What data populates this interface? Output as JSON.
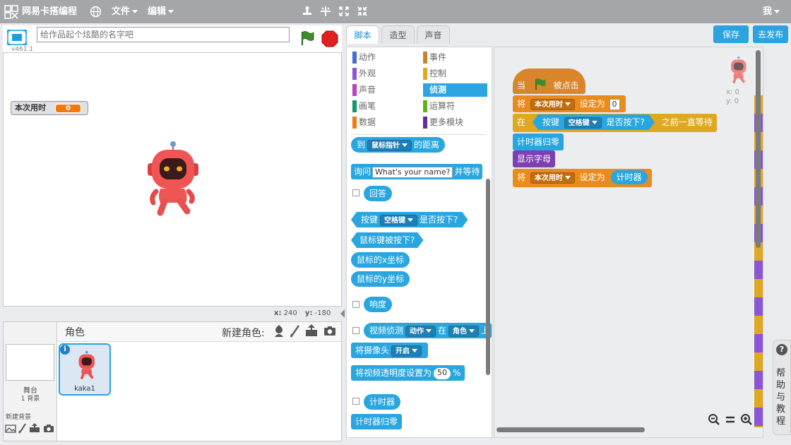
{
  "menubar": {
    "app_title": "网易卡搭编程",
    "file": "文件",
    "edit": "编辑",
    "user": "我"
  },
  "stage": {
    "project_placeholder": "给作品起个炫酷的名字吧",
    "version": "v461.1",
    "coord_x_label": "x:",
    "coord_x": "240",
    "coord_y_label": "y:",
    "coord_y": "-180"
  },
  "watcher": {
    "label": "本次用时",
    "value": "0"
  },
  "sprites": {
    "header": "角色",
    "new_sprite": "新建角色:",
    "sprite_name": "kaka1",
    "stage_label": "舞台",
    "backdrop_count": "1 背景",
    "new_backdrop": "新建背景"
  },
  "tabs": {
    "scripts": "脚本",
    "costumes": "造型",
    "sounds": "声音"
  },
  "actions": {
    "save": "保存",
    "publish": "去发布"
  },
  "categories": [
    {
      "label": "动作",
      "color": "#4a6cd4"
    },
    {
      "label": "事件",
      "color": "#c88330"
    },
    {
      "label": "外观",
      "color": "#8a55d7"
    },
    {
      "label": "控制",
      "color": "#e1a91a"
    },
    {
      "label": "声音",
      "color": "#bb42c3"
    },
    {
      "label": "侦测",
      "color": "#2ca5e2"
    },
    {
      "label": "画笔",
      "color": "#0e9a6c"
    },
    {
      "label": "运算符",
      "color": "#5cb712"
    },
    {
      "label": "数据",
      "color": "#ee7d16"
    },
    {
      "label": "更多模块",
      "color": "#632d99"
    }
  ],
  "palette": {
    "b1_to": "到",
    "b1_drop": "鼠标指针",
    "b1_tail": "的距离",
    "b2_ask": "询问",
    "b2_input": "What's your name?",
    "b2_tail": "并等待",
    "b3": "回答",
    "b4_key": "按键",
    "b4_drop": "空格键",
    "b4_tail": "是否按下?",
    "b5": "鼠标键被按下?",
    "b6": "鼠标的x坐标",
    "b7": "鼠标的y坐标",
    "b8": "响度",
    "b9_video": "视频侦测",
    "b9_drop1": "动作",
    "b9_on": "在",
    "b9_drop2": "角色",
    "b9_tail": "上",
    "b10_cam": "将摄像头",
    "b10_drop": "开启",
    "b11_set": "将视频透明度设置为",
    "b11_val": "50",
    "b11_pct": "%",
    "b12": "计时器",
    "b13": "计时器归零"
  },
  "script": {
    "hat_when": "当",
    "hat_click": "被点击",
    "s1_set": "将",
    "s1_var": "本次用时",
    "s1_to": "设定为",
    "s1_val": "0",
    "s2_at": "在",
    "s2_key": "按键",
    "s2_drop": "空格键",
    "s2_pressed": "是否按下?",
    "s2_wait": "之前一直等待",
    "s3": "计时器归零",
    "s4": "显示字母",
    "s5_set": "将",
    "s5_var": "本次用时",
    "s5_to": "设定为",
    "s5_timer": "计时器",
    "xy_x": "x: 0",
    "xy_y": "y: 0"
  },
  "help": {
    "label": "帮助与教程"
  }
}
